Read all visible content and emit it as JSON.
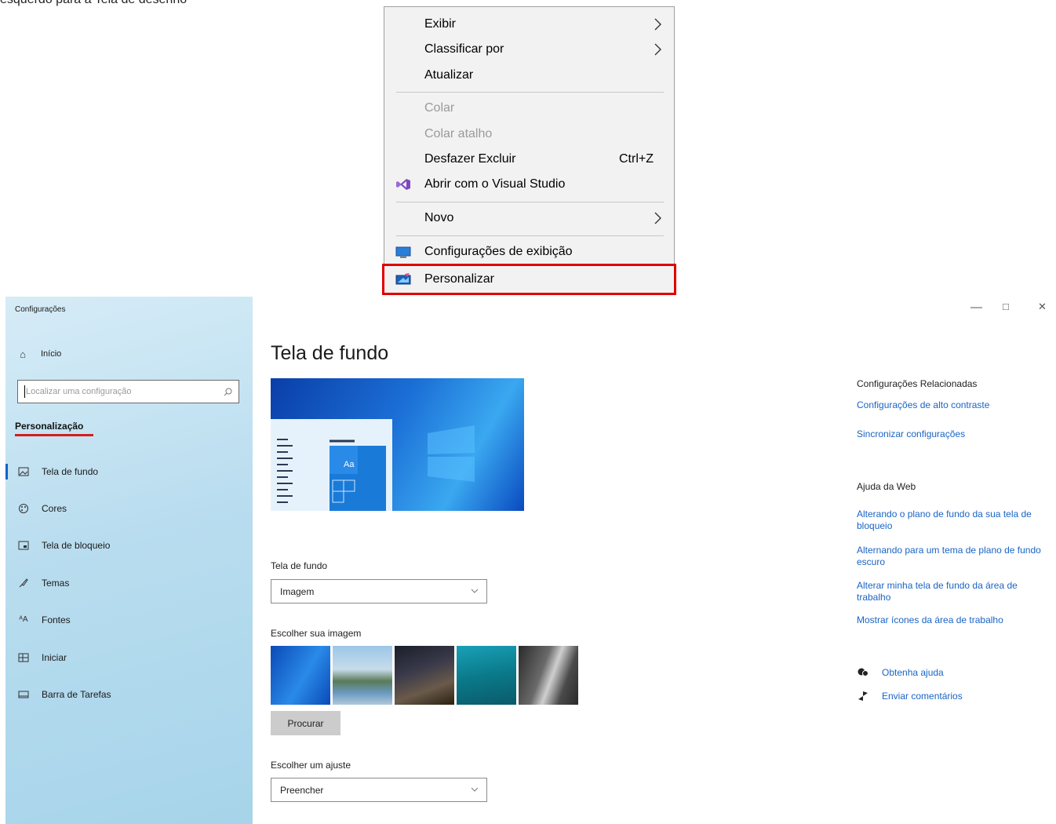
{
  "caption": "esquerdo para a Tela de desenho",
  "context_menu": {
    "items": [
      {
        "label": "Exibir",
        "submenu": true
      },
      {
        "label": "Classificar por",
        "submenu": true
      },
      {
        "label": "Atualizar"
      },
      {
        "label": "Colar",
        "disabled": true
      },
      {
        "label": "Colar atalho",
        "disabled": true
      },
      {
        "label": "Desfazer Excluir",
        "shortcut": "Ctrl+Z"
      },
      {
        "label": "Abrir com o Visual Studio",
        "icon": "visual-studio-icon"
      },
      {
        "label": "Novo",
        "submenu": true
      },
      {
        "label": "Configurações de exibição",
        "icon": "display-icon"
      },
      {
        "label": "Personalizar",
        "icon": "personalize-icon",
        "highlighted": true
      }
    ],
    "highlight_color": "#e00000"
  },
  "settings": {
    "app_title": "Configurações",
    "home": "Início",
    "search_placeholder": "Localizar uma configuração",
    "section": "Personalização",
    "nav": [
      {
        "label": "Tela de fundo",
        "icon": "image-icon",
        "active": true
      },
      {
        "label": "Cores",
        "icon": "palette-icon"
      },
      {
        "label": "Tela de bloqueio",
        "icon": "lock-screen-icon"
      },
      {
        "label": "Temas",
        "icon": "brush-icon"
      },
      {
        "label": "Fontes",
        "icon": "font-icon"
      },
      {
        "label": "Iniciar",
        "icon": "start-icon"
      },
      {
        "label": "Barra de Tarefas",
        "icon": "taskbar-icon"
      }
    ],
    "page_title": "Tela de fundo",
    "preview_tile_label": "Aa",
    "background_label": "Tela de fundo",
    "background_value": "Imagem",
    "choose_image_label": "Escolher sua imagem",
    "browse_button": "Procurar",
    "fit_label": "Escolher um ajuste",
    "fit_value": "Preencher",
    "related": {
      "heading": "Configurações Relacionadas",
      "links": [
        "Configurações de alto contraste",
        "Sincronizar configurações"
      ]
    },
    "help": {
      "heading": "Ajuda da Web",
      "links": [
        "Alterando o plano de fundo da sua tela de bloqueio",
        "Alternando para um tema de plano de fundo escuro",
        "Alterar minha tela de fundo da área de trabalho",
        "Mostrar ícones da área de trabalho"
      ]
    },
    "footer_links": [
      {
        "label": "Obtenha ajuda",
        "icon": "help-icon"
      },
      {
        "label": "Enviar comentários",
        "icon": "feedback-icon"
      }
    ],
    "window_controls": {
      "minimize": "—",
      "maximize": "□",
      "close": "✕"
    }
  },
  "colors": {
    "accent": "#0a64c8",
    "link": "#1a64c4",
    "underline": "#d21f1f"
  }
}
